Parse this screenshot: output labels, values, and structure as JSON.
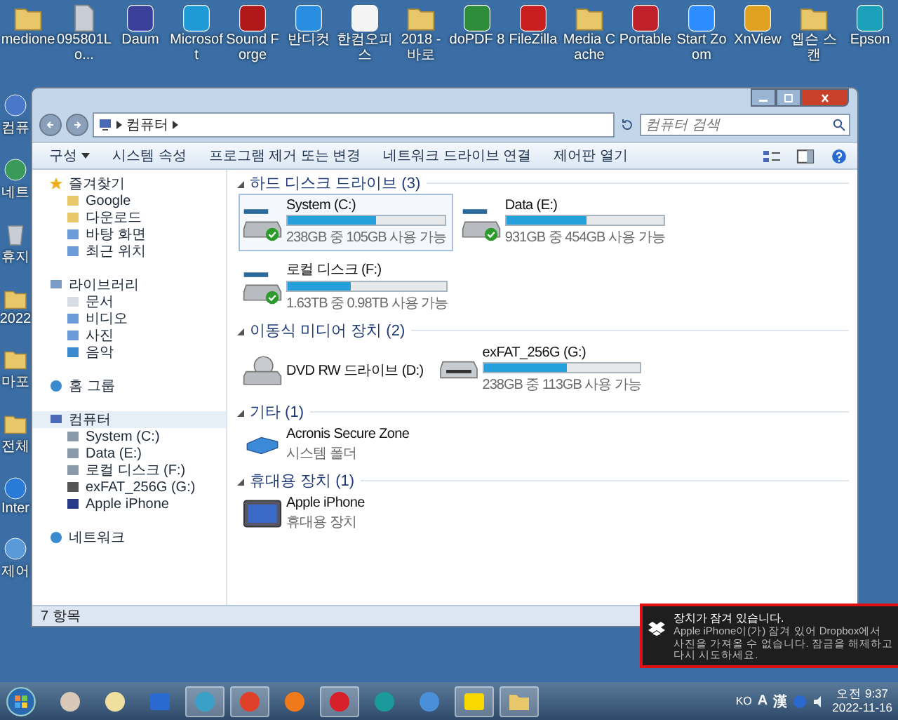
{
  "desktop_top": [
    {
      "label": "medione",
      "kind": "folder",
      "color": "#e8c66a"
    },
    {
      "label": "095801Lo...",
      "kind": "file",
      "color": "#c8ccd4"
    },
    {
      "label": "Daum",
      "kind": "app",
      "color": "#3a3f9a"
    },
    {
      "label": "Microsoft",
      "kind": "app",
      "color": "#1e9bd7"
    },
    {
      "label": "Sound Forge",
      "kind": "app",
      "color": "#b01818"
    },
    {
      "label": "반디컷",
      "kind": "app",
      "color": "#2a8ee0"
    },
    {
      "label": "한컴오피스",
      "kind": "app",
      "color": "#f4f4f4"
    },
    {
      "label": "2018 - 바로",
      "kind": "folder",
      "color": "#e8c66a"
    },
    {
      "label": "doPDF 8",
      "kind": "app",
      "color": "#2e8b3a"
    },
    {
      "label": "FileZilla",
      "kind": "app",
      "color": "#c81e1e"
    },
    {
      "label": "Media Cache",
      "kind": "folder",
      "color": "#e8c66a"
    },
    {
      "label": "Portable",
      "kind": "app",
      "color": "#c0202a"
    },
    {
      "label": "Start Zoom",
      "kind": "app",
      "color": "#2d8cff"
    },
    {
      "label": "XnView",
      "kind": "app",
      "color": "#e0a020"
    },
    {
      "label": "엡슨 스캔",
      "kind": "folder",
      "color": "#e8c66a"
    },
    {
      "label": "Epson",
      "kind": "app",
      "color": "#1aa0b8"
    }
  ],
  "desktop_left": [
    {
      "label": "컴퓨",
      "kind": "app",
      "color": "#4a78c8"
    },
    {
      "label": "네트",
      "kind": "app",
      "color": "#3a9a5a"
    },
    {
      "label": "휴지",
      "kind": "file",
      "color": "#c8ccd4"
    },
    {
      "label": "2022",
      "kind": "folder",
      "color": "#e8c66a"
    },
    {
      "label": "마포",
      "kind": "folder",
      "color": "#e8c66a"
    },
    {
      "label": "전체",
      "kind": "folder",
      "color": "#e8c66a"
    },
    {
      "label": "Inter",
      "kind": "app",
      "color": "#2a7ad8"
    },
    {
      "label": "제어",
      "kind": "app",
      "color": "#5a9ad8"
    }
  ],
  "window": {
    "address": "컴퓨터",
    "search": {
      "placeholder": "컴퓨터 검색"
    },
    "toolbar": [
      {
        "label": "구성",
        "dropdown": true
      },
      {
        "label": "시스템 속성",
        "dropdown": false
      },
      {
        "label": "프로그램 제거 또는 변경",
        "dropdown": false
      },
      {
        "label": "네트워크 드라이브 연결",
        "dropdown": false
      },
      {
        "label": "제어판 열기",
        "dropdown": false
      }
    ],
    "sidebar": [
      {
        "label": "즐겨찾기",
        "kind": "star",
        "selected": false,
        "children": [
          {
            "label": "Google",
            "kind": "folder"
          },
          {
            "label": "다운로드",
            "kind": "folder"
          },
          {
            "label": "바탕 화면",
            "kind": "screen"
          },
          {
            "label": "최근 위치",
            "kind": "screen"
          }
        ]
      },
      {
        "label": "라이브러리",
        "kind": "library",
        "selected": false,
        "children": [
          {
            "label": "문서",
            "kind": "doc"
          },
          {
            "label": "비디오",
            "kind": "screen"
          },
          {
            "label": "사진",
            "kind": "screen"
          },
          {
            "label": "음악",
            "kind": "music"
          }
        ]
      },
      {
        "label": "홈 그룹",
        "kind": "homegroup",
        "selected": false
      },
      {
        "label": "컴퓨터",
        "kind": "computer",
        "selected": true,
        "children": [
          {
            "label": "System (C:)",
            "kind": "drive"
          },
          {
            "label": "Data (E:)",
            "kind": "drive"
          },
          {
            "label": "로컬 디스크 (F:)",
            "kind": "drive"
          },
          {
            "label": "exFAT_256G (G:)",
            "kind": "usb"
          },
          {
            "label": "Apple iPhone",
            "kind": "device"
          }
        ]
      },
      {
        "label": "네트워크",
        "kind": "network",
        "selected": false
      }
    ],
    "sections": [
      {
        "title": "하드 디스크 드라이브 (3)",
        "expanded": true,
        "items": [
          {
            "kind": "disk",
            "name": "System (C:)",
            "selected": true,
            "ok": true,
            "level": 0.56,
            "info": "238GB 중 105GB 사용 가능"
          },
          {
            "kind": "disk",
            "name": "Data (E:)",
            "selected": false,
            "ok": true,
            "level": 0.51,
            "info": "931GB 중 454GB 사용 가능"
          },
          {
            "kind": "disk",
            "name": "로컬 디스크 (F:)",
            "selected": false,
            "ok": true,
            "level": 0.4,
            "info": "1.63TB 중 0.98TB 사용 가능"
          }
        ]
      },
      {
        "title": "이동식 미디어 장치 (2)",
        "expanded": true,
        "items": [
          {
            "kind": "dvd",
            "name": "DVD RW 드라이브 (D:)",
            "selected": false
          },
          {
            "kind": "usb",
            "name": "exFAT_256G (G:)",
            "selected": false,
            "ok": false,
            "level": 0.53,
            "info": "238GB 중 113GB 사용 가능"
          }
        ]
      },
      {
        "title": "기타 (1)",
        "expanded": true,
        "items": [
          {
            "kind": "folder",
            "name": "Acronis Secure Zone",
            "selected": false,
            "info": "시스템 폴더"
          }
        ]
      },
      {
        "title": "휴대용 장치 (1)",
        "expanded": true,
        "items": [
          {
            "kind": "device",
            "name": "Apple iPhone",
            "selected": false,
            "info": "휴대용 장치"
          }
        ]
      }
    ],
    "status": "7 항목"
  },
  "notification": {
    "title": "장치가 잠겨 있습니다.",
    "body": "Apple iPhone이(가) 잠겨 있어 Dropbox에서 사진을 가져올 수 없습니다. 잠금을 해제하고 다시 시도하세요."
  },
  "taskbar": {
    "items": [
      {
        "kind": "round",
        "color": "#d8c8b8",
        "active": false
      },
      {
        "kind": "round",
        "color": "#f0e0a0",
        "active": false
      },
      {
        "kind": "square",
        "color": "#2a6ad0",
        "active": false
      },
      {
        "kind": "round",
        "color": "#3aa0c8",
        "active": true
      },
      {
        "kind": "round",
        "color": "#e0402a",
        "active": true
      },
      {
        "kind": "round",
        "color": "#f07a1a",
        "active": false
      },
      {
        "kind": "round",
        "color": "#d8202a",
        "active": true
      },
      {
        "kind": "round",
        "color": "#1a9a9a",
        "active": false
      },
      {
        "kind": "round",
        "color": "#4a90d8",
        "active": false
      },
      {
        "kind": "square",
        "color": "#f8d800",
        "active": true
      },
      {
        "kind": "folder",
        "color": "#e8c66a",
        "active": true
      }
    ],
    "lang": "KO",
    "ime": [
      "A",
      "漢"
    ],
    "time": "오전 9:37",
    "date": "2022-11-16"
  }
}
